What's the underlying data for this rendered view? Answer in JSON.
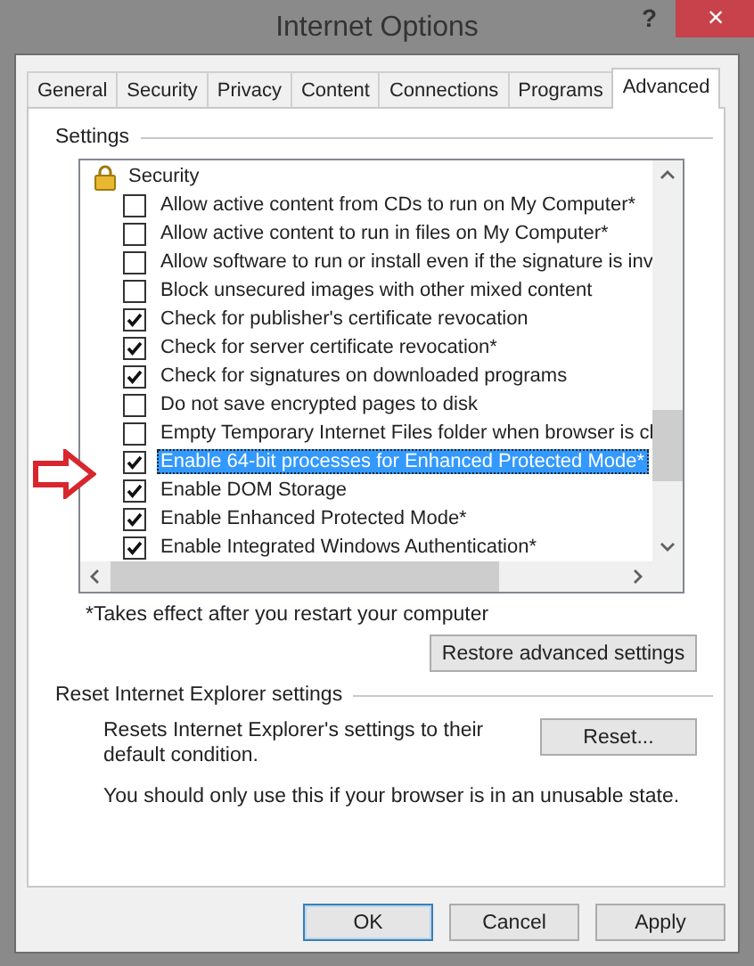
{
  "window": {
    "title": "Internet Options",
    "help_button": "?",
    "close_button": "×"
  },
  "tabs": [
    {
      "label": "General",
      "selected": false
    },
    {
      "label": "Security",
      "selected": false
    },
    {
      "label": "Privacy",
      "selected": false
    },
    {
      "label": "Content",
      "selected": false
    },
    {
      "label": "Connections",
      "selected": false
    },
    {
      "label": "Programs",
      "selected": false
    },
    {
      "label": "Advanced",
      "selected": true
    }
  ],
  "settings": {
    "title": "Settings",
    "items": [
      {
        "kind": "group",
        "label": "Security"
      },
      {
        "kind": "check",
        "label": "Allow active content from CDs to run on My Computer*",
        "checked": false,
        "selected": false
      },
      {
        "kind": "check",
        "label": "Allow active content to run in files on My Computer*",
        "checked": false,
        "selected": false
      },
      {
        "kind": "check",
        "label": "Allow software to run or install even if the signature is inv",
        "checked": false,
        "selected": false
      },
      {
        "kind": "check",
        "label": "Block unsecured images with other mixed content",
        "checked": false,
        "selected": false
      },
      {
        "kind": "check",
        "label": "Check for publisher's certificate revocation",
        "checked": true,
        "selected": false
      },
      {
        "kind": "check",
        "label": "Check for server certificate revocation*",
        "checked": true,
        "selected": false
      },
      {
        "kind": "check",
        "label": "Check for signatures on downloaded programs",
        "checked": true,
        "selected": false
      },
      {
        "kind": "check",
        "label": "Do not save encrypted pages to disk",
        "checked": false,
        "selected": false
      },
      {
        "kind": "check",
        "label": "Empty Temporary Internet Files folder when browser is cl",
        "checked": false,
        "selected": false
      },
      {
        "kind": "check",
        "label": "Enable 64-bit processes for Enhanced Protected Mode*",
        "checked": true,
        "selected": true
      },
      {
        "kind": "check",
        "label": "Enable DOM Storage",
        "checked": true,
        "selected": false
      },
      {
        "kind": "check",
        "label": "Enable Enhanced Protected Mode*",
        "checked": true,
        "selected": false
      },
      {
        "kind": "check",
        "label": "Enable Integrated Windows Authentication*",
        "checked": true,
        "selected": false
      }
    ],
    "note": "*Takes effect after you restart your computer",
    "restore_button": "Restore advanced settings"
  },
  "reset": {
    "title": "Reset Internet Explorer settings",
    "description": "Resets Internet Explorer's settings to their default condition.",
    "reset_button": "Reset...",
    "warning": "You should only use this if your browser is in an unusable state."
  },
  "buttons": [
    {
      "label": "OK",
      "kind": "default"
    },
    {
      "label": "Cancel",
      "kind": "normal"
    },
    {
      "label": "Apply",
      "kind": "normal"
    }
  ]
}
